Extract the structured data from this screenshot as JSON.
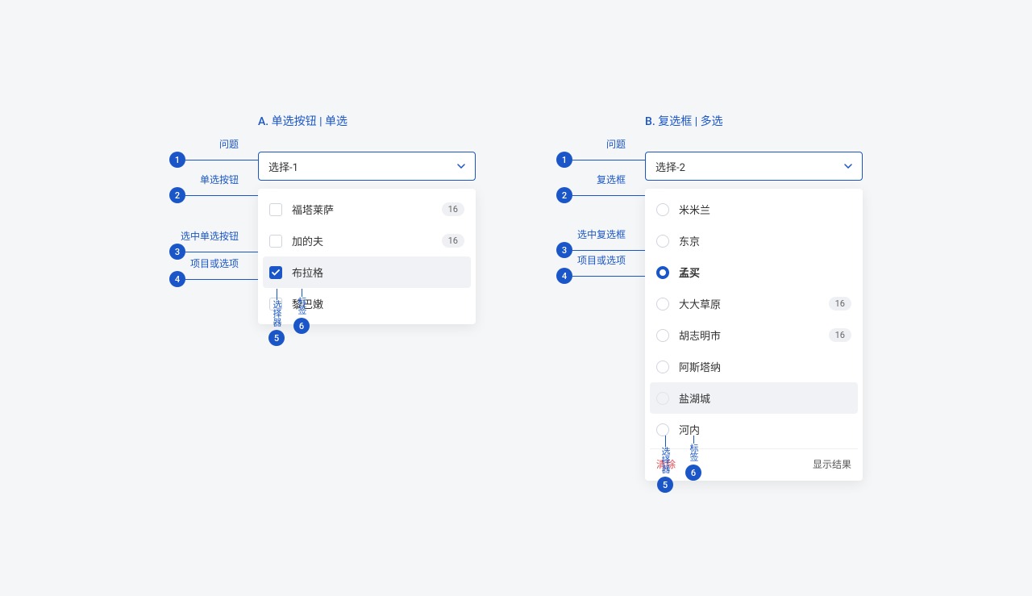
{
  "sectionA": {
    "letter": "A.",
    "title": "单选按钮 | 单选",
    "selectValue": "选择-1",
    "options": [
      {
        "label": "福塔莱萨",
        "badge": "16",
        "checked": false
      },
      {
        "label": "加的夫",
        "badge": "16",
        "checked": false
      },
      {
        "label": "布拉格",
        "badge": null,
        "checked": true
      },
      {
        "label": "黎巴嫩",
        "badge": null,
        "checked": false
      }
    ],
    "annotations": {
      "a1": "问题",
      "a2": "单选按钮",
      "a3": "选中单选按钮",
      "a4": "项目或选项",
      "a5": "选择器",
      "a6": "标签"
    }
  },
  "sectionB": {
    "letter": "B.",
    "title": "复选框 | 多选",
    "selectValue": "选择-2",
    "options": [
      {
        "label": "米米兰",
        "badge": null,
        "checked": false
      },
      {
        "label": "东京",
        "badge": null,
        "checked": false
      },
      {
        "label": "孟买",
        "badge": null,
        "checked": true
      },
      {
        "label": "大大草原",
        "badge": "16",
        "checked": false
      },
      {
        "label": "胡志明市",
        "badge": "16",
        "checked": false
      },
      {
        "label": "阿斯塔纳",
        "badge": null,
        "checked": false
      },
      {
        "label": "盐湖城",
        "badge": null,
        "checked": false,
        "hover": true
      },
      {
        "label": "河内",
        "badge": null,
        "checked": false
      }
    ],
    "clearLabel": "清除",
    "showLabel": "显示结果",
    "annotations": {
      "a1": "问题",
      "a2": "复选框",
      "a3": "选中复选框",
      "a4": "项目或选项",
      "a5": "选择器",
      "a6": "标签"
    }
  },
  "nums": {
    "n1": "1",
    "n2": "2",
    "n3": "3",
    "n4": "4",
    "n5": "5",
    "n6": "6"
  }
}
